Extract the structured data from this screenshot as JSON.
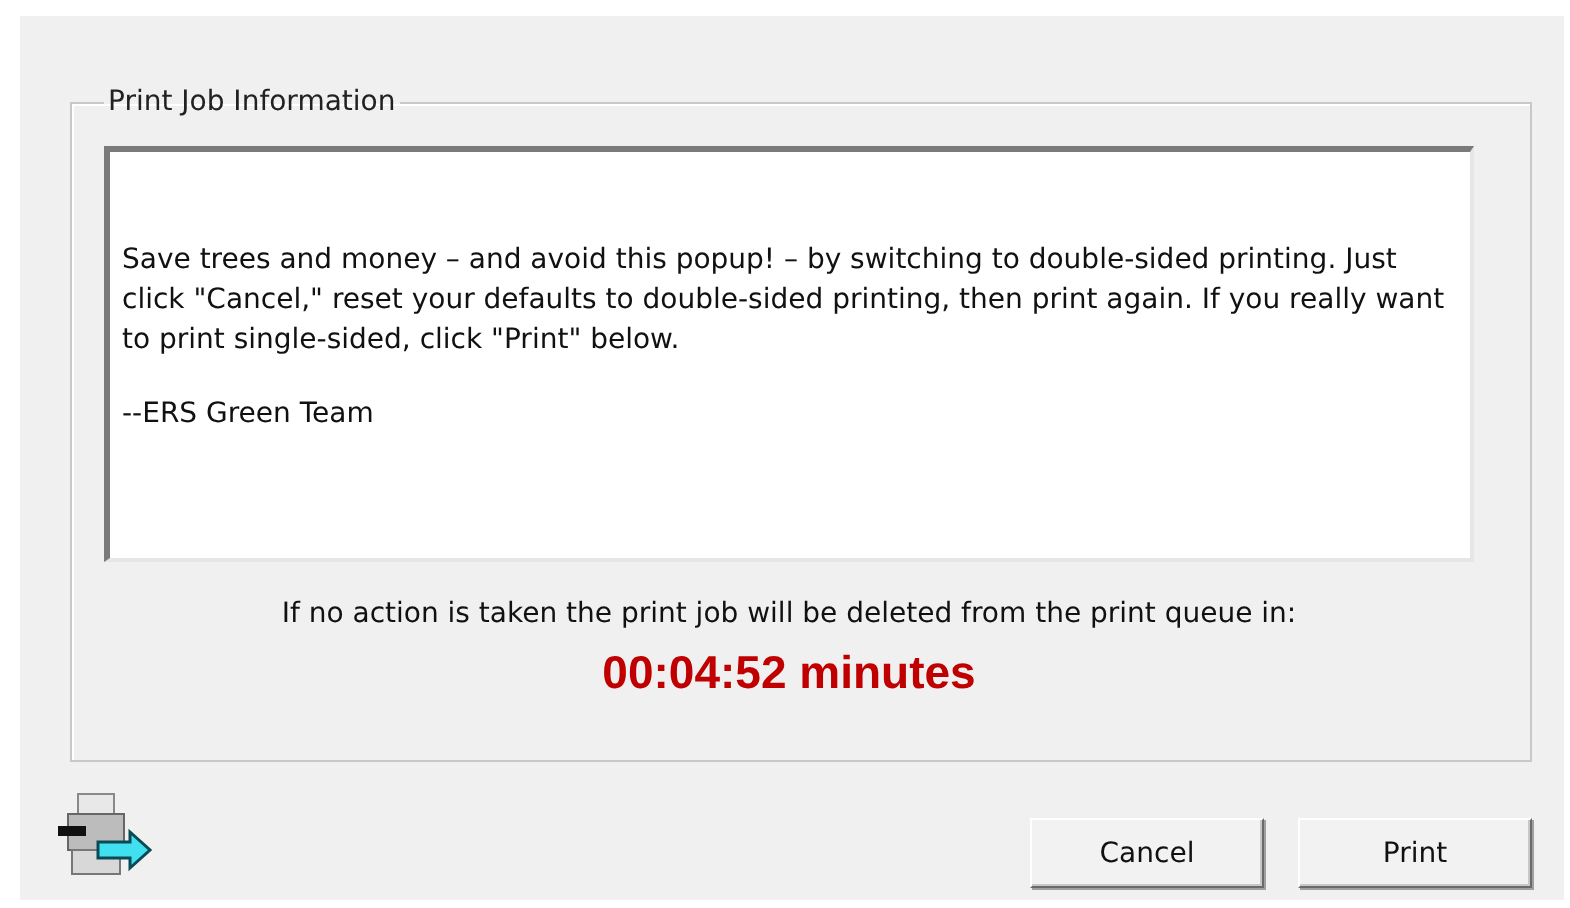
{
  "group": {
    "title": "Print Job Information"
  },
  "message": {
    "paragraphs": [
      "Save trees and money – and avoid this popup! – by switching to double-sided printing. Just click \"Cancel,\" reset your defaults to double-sided printing, then print again.  If you really want to print single-sided, click \"Print\" below.",
      "--ERS Green Team"
    ]
  },
  "notice": "If no action is taken the print job will be deleted from the print queue in:",
  "countdown": "00:04:52 minutes",
  "buttons": [
    {
      "label": "Cancel"
    },
    {
      "label": "Print"
    }
  ]
}
